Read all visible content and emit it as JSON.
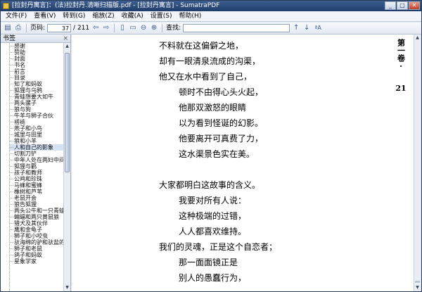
{
  "window": {
    "title": "[拉封丹寓言]：(法)拉封丹.清晰扫描版.pdf - [拉封丹寓言] - SumatraPDF"
  },
  "menu": [
    "文件(F)",
    "查看(V)",
    "转到(G)",
    "缩放(Z)",
    "收藏(A)",
    "设置(S)",
    "帮助(H)"
  ],
  "toolbar": {
    "page_label": "页码:",
    "page_current": "37",
    "page_total": "/ 211",
    "find_label": "查找:",
    "search_value": ""
  },
  "sidebar": {
    "header": "书签",
    "items": [
      "感谢",
      "赞助",
      "封面",
      "书名",
      "前言",
      "目录",
      "知了和蚂蚁",
      "狐狸与乌鸦",
      "青蛙想要大如牛",
      "两头骡子",
      "狼与狗",
      "牛羊与狮子合伙",
      "褡裢",
      "燕子和小鸟",
      "城里与田里",
      "狼和小羊",
      "人和自己的影象",
      "切割刀铲",
      "中年人处在两妇中间",
      "狐狸与鹳",
      "孩子和教师",
      "公鸡和珍珠",
      "马蜂和蜜蜂",
      "橡树和芦苇",
      "老鼠开会",
      "狼告狐狸",
      "两头公牛和一只青蛙",
      "蝙蝠和两只黄鼠狼",
      "猎犬及其伙伴",
      "鹰和金龟子",
      "狮子和小咬虫",
      "驮海绵的驴和驮盐的驴",
      "狮子和老鼠",
      "鸽子和蚂蚁",
      "星象学家"
    ],
    "selected_index": 16
  },
  "page": {
    "lines": [
      {
        "text": "不料就在这偏僻之地，",
        "indent": false
      },
      {
        "text": "却有一眼清泉流成的沟渠，",
        "indent": false
      },
      {
        "text": "他又在水中看到了自己，",
        "indent": false
      },
      {
        "text": "顿时不由得心头火起，",
        "indent": true
      },
      {
        "text": "他那双激怒的眼睛",
        "indent": true
      },
      {
        "text": "以为看到怪诞的幻影。",
        "indent": true
      },
      {
        "text": "他要离开可真费了力，",
        "indent": true
      },
      {
        "text": "这水渠景色实在美。",
        "indent": true
      },
      {
        "text": "",
        "indent": false
      },
      {
        "text": "大家都明白这故事的含义。",
        "indent": false
      },
      {
        "text": "我要对所有人说：",
        "indent": true
      },
      {
        "text": "这种极端的过错，",
        "indent": true
      },
      {
        "text": "人人都喜欢维持。",
        "indent": true
      },
      {
        "text": "我们的灵魂，正是这个自恋者；",
        "indent": false
      },
      {
        "text": "那一面面镜正是",
        "indent": true
      },
      {
        "text": "别人的愚蠢行为，",
        "indent": true
      }
    ],
    "running_head": "第一卷",
    "dot": "·",
    "number": "21"
  }
}
